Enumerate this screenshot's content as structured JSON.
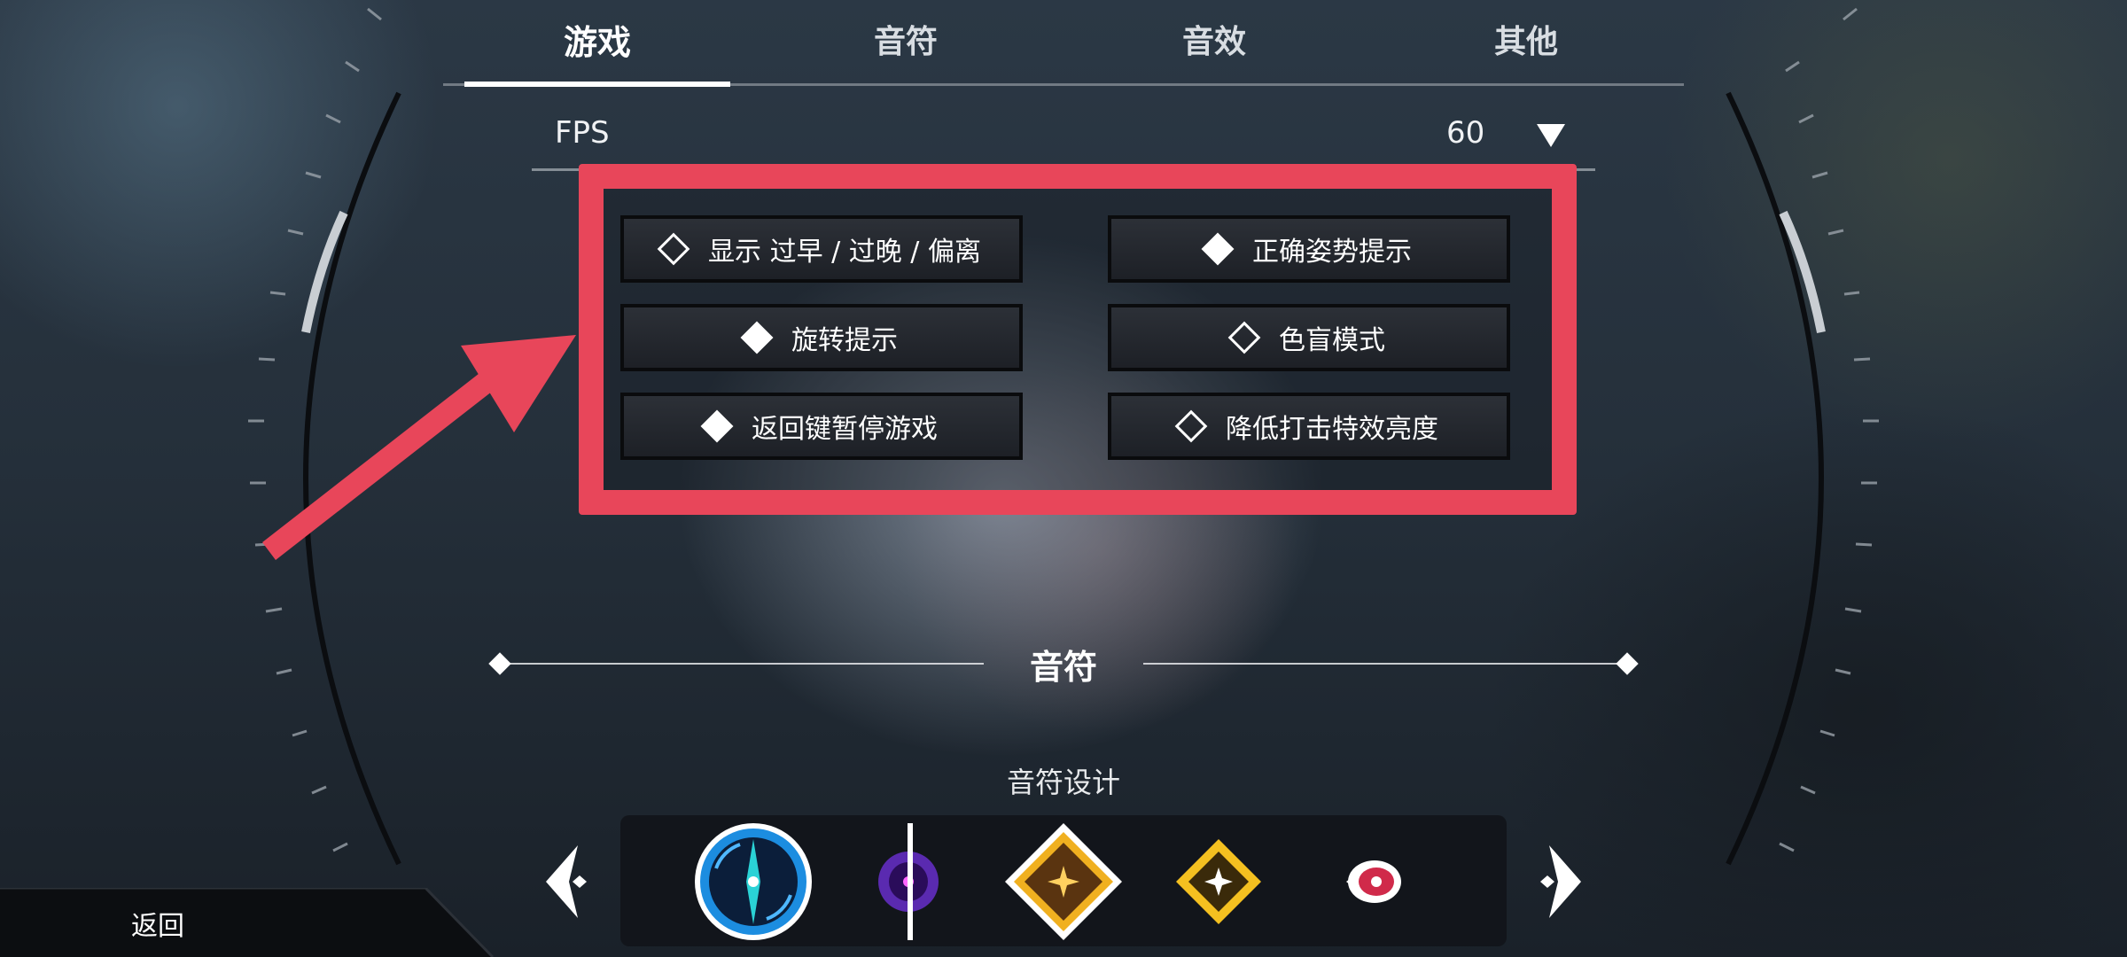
{
  "tabs": [
    {
      "label": "游戏",
      "active": true
    },
    {
      "label": "音符",
      "active": false
    },
    {
      "label": "音效",
      "active": false
    },
    {
      "label": "其他",
      "active": false
    }
  ],
  "fps": {
    "label": "FPS",
    "value": "60"
  },
  "options": [
    {
      "label": "显示 过早 / 过晚 / 偏离",
      "checked": false
    },
    {
      "label": "正确姿势提示",
      "checked": true
    },
    {
      "label": "旋转提示",
      "checked": true
    },
    {
      "label": "色盲模式",
      "checked": false
    },
    {
      "label": "返回键暂停游戏",
      "checked": true
    },
    {
      "label": "降低打击特效亮度",
      "checked": false
    }
  ],
  "section": {
    "title": "音符"
  },
  "note_design": {
    "label": "音符设计",
    "items": [
      "blue-circle-note-icon",
      "purple-orb-note-icon",
      "gold-diamond-note-icon",
      "small-gold-diamond-note-icon",
      "red-eye-note-icon"
    ]
  },
  "back": {
    "label": "返回"
  },
  "colors": {
    "highlight": "#e8465a",
    "arrow": "#e8465a",
    "background": "#25303b"
  }
}
